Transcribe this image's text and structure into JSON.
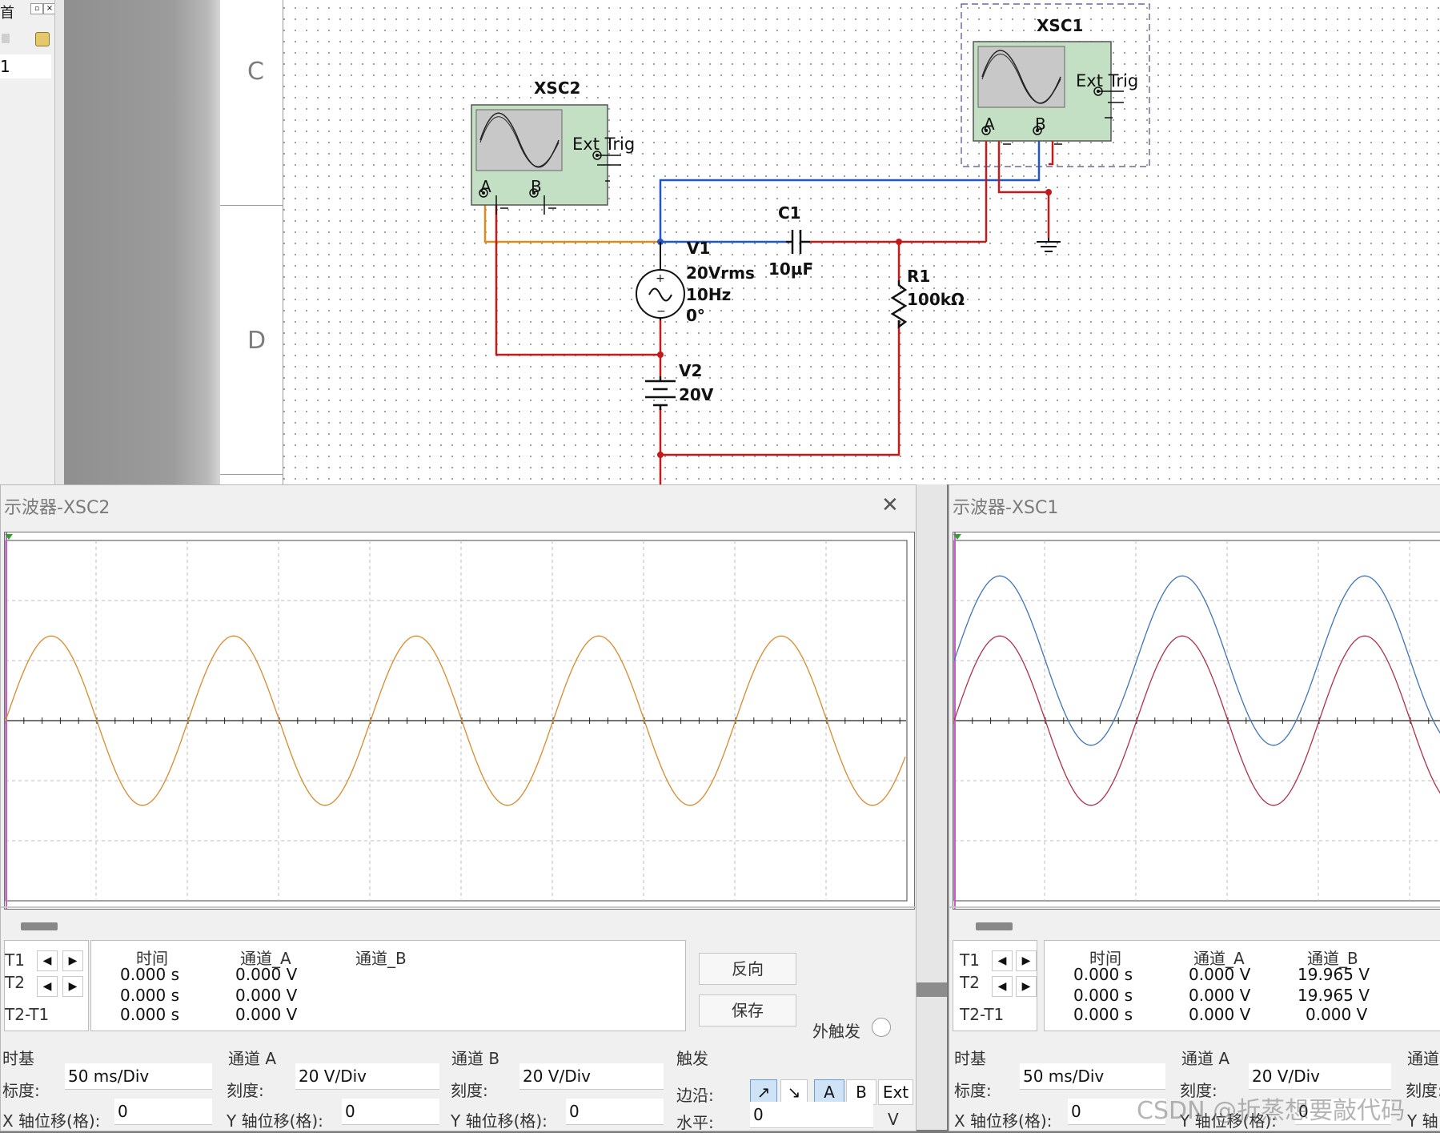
{
  "left_panel": {
    "tab_char": "首",
    "row_value": "1"
  },
  "schematic": {
    "row_labels": [
      "C",
      "D"
    ],
    "xsc2": {
      "name": "XSC2",
      "ext_trig": "Ext Trig",
      "pin_a": "A",
      "pin_b": "B"
    },
    "xsc1": {
      "name": "XSC1",
      "ext_trig": "Ext Trig",
      "pin_a": "A",
      "pin_b": "B"
    },
    "v1": {
      "name": "V1",
      "amplitude": "20Vrms",
      "freq": "10Hz",
      "phase": "0°"
    },
    "c1": {
      "name": "C1",
      "value": "10µF"
    },
    "r1": {
      "name": "R1",
      "value": "100kΩ"
    },
    "v2": {
      "name": "V2",
      "value": "20V"
    },
    "wire_colors": {
      "blue": "#1f57c7",
      "red": "#c41a1a",
      "orange": "#e08a1e"
    }
  },
  "scope_xsc2": {
    "title": "示波器-XSC2",
    "close": "✕",
    "trace_color": "#d88a2b",
    "readout": {
      "headers": [
        "时间",
        "通道_A",
        "通道_B"
      ],
      "rows": [
        {
          "label": "T1",
          "time": "0.000 s",
          "a": "0.000 V",
          "b": ""
        },
        {
          "label": "T2",
          "time": "0.000 s",
          "a": "0.000 V",
          "b": ""
        },
        {
          "label": "T2-T1",
          "time": "0.000 s",
          "a": "0.000 V",
          "b": ""
        }
      ]
    },
    "buttons": {
      "reverse": "反向",
      "save": "保存",
      "ext_trigger": "外触发"
    },
    "timebase": {
      "title": "时基",
      "scale_label": "标度:",
      "scale": "50 ms/Div",
      "xpos_label": "X 轴位移(格):",
      "xpos": "0"
    },
    "channel_a": {
      "title": "通道 A",
      "scale_label": "刻度:",
      "scale": "20  V/Div",
      "ypos_label": "Y 轴位移(格):",
      "ypos": "0"
    },
    "channel_b": {
      "title": "通道 B",
      "scale_label": "刻度:",
      "scale": "20  V/Div",
      "ypos_label": "Y 轴位移(格):",
      "ypos": "0"
    },
    "trigger": {
      "title": "触发",
      "edge_label": "边沿:",
      "level_label": "水平:",
      "level": "0",
      "level_unit": "V",
      "src_a": "A",
      "src_b": "B",
      "src_ext": "Ext",
      "rise": "↗",
      "fall": "↘"
    }
  },
  "scope_xsc1": {
    "title": "示波器-XSC1",
    "trace_a_color": "#b0304a",
    "trace_b_color": "#3f74b6",
    "readout": {
      "headers": [
        "时间",
        "通道_A",
        "通道_B"
      ],
      "rows": [
        {
          "label": "T1",
          "time": "0.000 s",
          "a": "0.000 V",
          "b": "19.965 V"
        },
        {
          "label": "T2",
          "time": "0.000 s",
          "a": "0.000 V",
          "b": "19.965 V"
        },
        {
          "label": "T2-T1",
          "time": "0.000 s",
          "a": "0.000 V",
          "b": "0.000 V"
        }
      ]
    },
    "timebase": {
      "title": "时基",
      "scale_label": "标度:",
      "scale": "50 ms/Div",
      "xpos_label": "X 轴位移(格):",
      "xpos": "0"
    },
    "channel_a": {
      "title": "通道 A",
      "scale_label": "刻度:",
      "scale": "20  V/Div",
      "ypos_label": "Y 轴位移(格):",
      "ypos": "0"
    },
    "channel_b_partial": {
      "title": "通道",
      "scale_label": "刻度:",
      "ypos_label": "Y 轴"
    }
  },
  "watermark": "CSDN @折蒸想要敲代码"
}
